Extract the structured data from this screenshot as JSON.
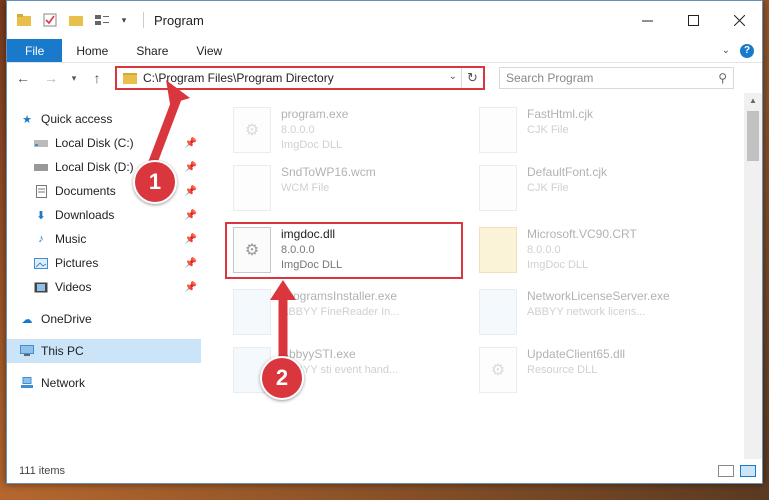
{
  "window": {
    "title": "Program"
  },
  "ribbon": {
    "tabs": [
      "File",
      "Home",
      "Share",
      "View"
    ]
  },
  "address": {
    "path": "C:\\Program Files\\Program Directory"
  },
  "search": {
    "placeholder": "Search Program"
  },
  "sidebar": {
    "quick_access": "Quick access",
    "items": [
      "Local Disk (C:)",
      "Local Disk (D:)",
      "Documents",
      "Downloads",
      "Music",
      "Pictures",
      "Videos"
    ],
    "onedrive": "OneDrive",
    "this_pc": "This PC",
    "network": "Network"
  },
  "files": [
    {
      "name": "program.exe",
      "line2": "8.0.0.0",
      "line3": "ImgDoc DLL"
    },
    {
      "name": "FastHtml.cjk",
      "line2": "CJK File",
      "line3": ""
    },
    {
      "name": "SndToWP16.wcm",
      "line2": "WCM File",
      "line3": ""
    },
    {
      "name": "DefaultFont.cjk",
      "line2": "CJK File",
      "line3": ""
    },
    {
      "name": "imgdoc.dll",
      "line2": "8.0.0.0",
      "line3": "ImgDoc DLL"
    },
    {
      "name": "Microsoft.VC90.CRT",
      "line2": "8.0.0.0",
      "line3": "ImgDoc DLL"
    },
    {
      "name": "ProgramsInstaller.exe",
      "line2": "ABBYY FineReader In...",
      "line3": ""
    },
    {
      "name": "NetworkLicenseServer.exe",
      "line2": "ABBYY network licens...",
      "line3": ""
    },
    {
      "name": "AbbyySTI.exe",
      "line2": "ABBYY sti event hand...",
      "line3": ""
    },
    {
      "name": "UpdateClient65.dll",
      "line2": "Resource DLL",
      "line3": ""
    }
  ],
  "status": {
    "count": "111 items"
  },
  "markers": {
    "one": "1",
    "two": "2"
  },
  "colors": {
    "accent": "#1979ca",
    "highlight": "#d9363e"
  }
}
